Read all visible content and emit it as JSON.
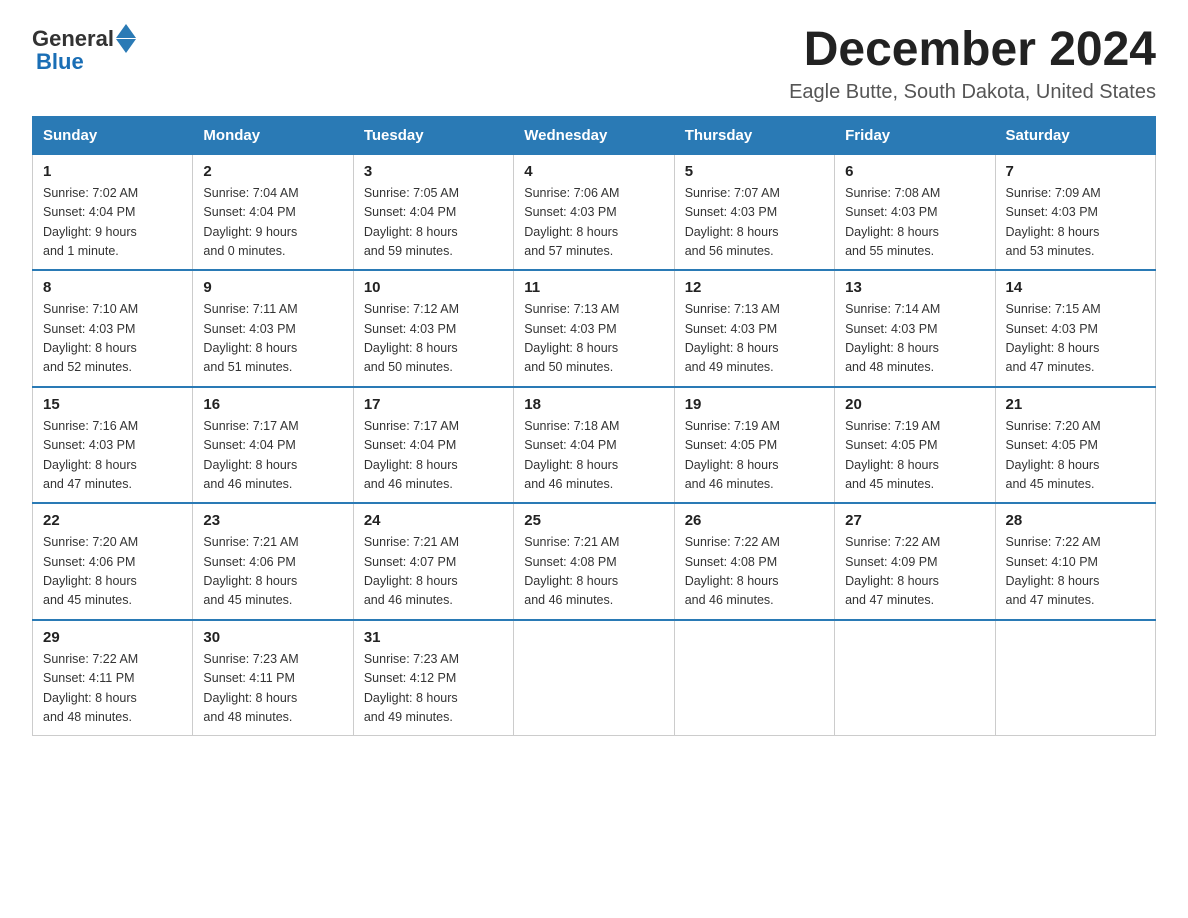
{
  "header": {
    "logo_general": "General",
    "logo_blue": "Blue",
    "month_title": "December 2024",
    "location": "Eagle Butte, South Dakota, United States"
  },
  "weekdays": [
    "Sunday",
    "Monday",
    "Tuesday",
    "Wednesday",
    "Thursday",
    "Friday",
    "Saturday"
  ],
  "weeks": [
    [
      {
        "day": "1",
        "sunrise": "7:02 AM",
        "sunset": "4:04 PM",
        "daylight": "9 hours and 1 minute."
      },
      {
        "day": "2",
        "sunrise": "7:04 AM",
        "sunset": "4:04 PM",
        "daylight": "9 hours and 0 minutes."
      },
      {
        "day": "3",
        "sunrise": "7:05 AM",
        "sunset": "4:04 PM",
        "daylight": "8 hours and 59 minutes."
      },
      {
        "day": "4",
        "sunrise": "7:06 AM",
        "sunset": "4:03 PM",
        "daylight": "8 hours and 57 minutes."
      },
      {
        "day": "5",
        "sunrise": "7:07 AM",
        "sunset": "4:03 PM",
        "daylight": "8 hours and 56 minutes."
      },
      {
        "day": "6",
        "sunrise": "7:08 AM",
        "sunset": "4:03 PM",
        "daylight": "8 hours and 55 minutes."
      },
      {
        "day": "7",
        "sunrise": "7:09 AM",
        "sunset": "4:03 PM",
        "daylight": "8 hours and 53 minutes."
      }
    ],
    [
      {
        "day": "8",
        "sunrise": "7:10 AM",
        "sunset": "4:03 PM",
        "daylight": "8 hours and 52 minutes."
      },
      {
        "day": "9",
        "sunrise": "7:11 AM",
        "sunset": "4:03 PM",
        "daylight": "8 hours and 51 minutes."
      },
      {
        "day": "10",
        "sunrise": "7:12 AM",
        "sunset": "4:03 PM",
        "daylight": "8 hours and 50 minutes."
      },
      {
        "day": "11",
        "sunrise": "7:13 AM",
        "sunset": "4:03 PM",
        "daylight": "8 hours and 50 minutes."
      },
      {
        "day": "12",
        "sunrise": "7:13 AM",
        "sunset": "4:03 PM",
        "daylight": "8 hours and 49 minutes."
      },
      {
        "day": "13",
        "sunrise": "7:14 AM",
        "sunset": "4:03 PM",
        "daylight": "8 hours and 48 minutes."
      },
      {
        "day": "14",
        "sunrise": "7:15 AM",
        "sunset": "4:03 PM",
        "daylight": "8 hours and 47 minutes."
      }
    ],
    [
      {
        "day": "15",
        "sunrise": "7:16 AM",
        "sunset": "4:03 PM",
        "daylight": "8 hours and 47 minutes."
      },
      {
        "day": "16",
        "sunrise": "7:17 AM",
        "sunset": "4:04 PM",
        "daylight": "8 hours and 46 minutes."
      },
      {
        "day": "17",
        "sunrise": "7:17 AM",
        "sunset": "4:04 PM",
        "daylight": "8 hours and 46 minutes."
      },
      {
        "day": "18",
        "sunrise": "7:18 AM",
        "sunset": "4:04 PM",
        "daylight": "8 hours and 46 minutes."
      },
      {
        "day": "19",
        "sunrise": "7:19 AM",
        "sunset": "4:05 PM",
        "daylight": "8 hours and 46 minutes."
      },
      {
        "day": "20",
        "sunrise": "7:19 AM",
        "sunset": "4:05 PM",
        "daylight": "8 hours and 45 minutes."
      },
      {
        "day": "21",
        "sunrise": "7:20 AM",
        "sunset": "4:05 PM",
        "daylight": "8 hours and 45 minutes."
      }
    ],
    [
      {
        "day": "22",
        "sunrise": "7:20 AM",
        "sunset": "4:06 PM",
        "daylight": "8 hours and 45 minutes."
      },
      {
        "day": "23",
        "sunrise": "7:21 AM",
        "sunset": "4:06 PM",
        "daylight": "8 hours and 45 minutes."
      },
      {
        "day": "24",
        "sunrise": "7:21 AM",
        "sunset": "4:07 PM",
        "daylight": "8 hours and 46 minutes."
      },
      {
        "day": "25",
        "sunrise": "7:21 AM",
        "sunset": "4:08 PM",
        "daylight": "8 hours and 46 minutes."
      },
      {
        "day": "26",
        "sunrise": "7:22 AM",
        "sunset": "4:08 PM",
        "daylight": "8 hours and 46 minutes."
      },
      {
        "day": "27",
        "sunrise": "7:22 AM",
        "sunset": "4:09 PM",
        "daylight": "8 hours and 47 minutes."
      },
      {
        "day": "28",
        "sunrise": "7:22 AM",
        "sunset": "4:10 PM",
        "daylight": "8 hours and 47 minutes."
      }
    ],
    [
      {
        "day": "29",
        "sunrise": "7:22 AM",
        "sunset": "4:11 PM",
        "daylight": "8 hours and 48 minutes."
      },
      {
        "day": "30",
        "sunrise": "7:23 AM",
        "sunset": "4:11 PM",
        "daylight": "8 hours and 48 minutes."
      },
      {
        "day": "31",
        "sunrise": "7:23 AM",
        "sunset": "4:12 PM",
        "daylight": "8 hours and 49 minutes."
      },
      null,
      null,
      null,
      null
    ]
  ],
  "labels": {
    "sunrise": "Sunrise:",
    "sunset": "Sunset:",
    "daylight": "Daylight:"
  }
}
